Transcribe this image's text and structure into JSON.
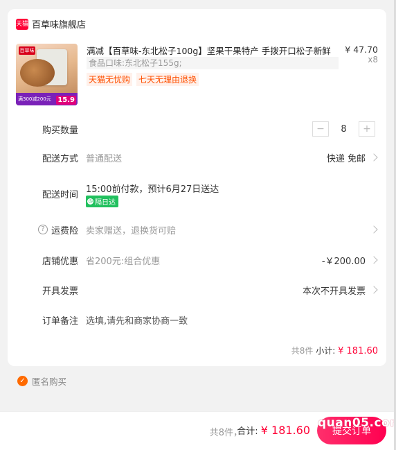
{
  "shop": {
    "logo_text": "天猫",
    "name": "百草味旗舰店"
  },
  "product": {
    "title": "满减【百草味-东北松子100g】坚果干果特产 手拨开口松子新鲜",
    "sku": "食品口味:东北松子155g;",
    "price": "¥ 47.70",
    "qty": "x8",
    "tags": [
      "天猫无忧购",
      "七天无理由退换"
    ],
    "image": {
      "brand": "百草味",
      "banner": "满300减200元",
      "price": "15.9"
    }
  },
  "rows": {
    "quantity": {
      "label": "购买数量",
      "minus": "−",
      "value": "8",
      "plus": "+"
    },
    "shipping": {
      "label": "配送方式",
      "value": "普通配送",
      "right": "快递 免邮"
    },
    "delivery_time": {
      "label": "配送时间",
      "value": "15:00前付款，预计6月27日送达",
      "badge": "隔日达"
    },
    "insurance": {
      "label": "运费险",
      "value": "卖家赠送，退换货可赔"
    },
    "discount": {
      "label": "店铺优惠",
      "value": "省200元:组合优惠",
      "right": "-￥200.00"
    },
    "invoice": {
      "label": "开具发票",
      "right": "本次不开具发票"
    },
    "note": {
      "label": "订单备注",
      "placeholder": "选填,请先和商家协商一致"
    }
  },
  "subtotal": {
    "count": "共8件",
    "label": "小计:",
    "amount": "¥ 181.60"
  },
  "anonymous": {
    "label": "匿名购买"
  },
  "bottom": {
    "count": "共8件，",
    "total_label": "合计:",
    "total_amount": "¥ 181.60",
    "submit": "提交订单",
    "watermark": "quan05.com"
  },
  "colors": {
    "accent": "#ff0036",
    "tag": "#ff5000",
    "badge_green": "#21c05e",
    "anon_orange": "#ff6a00"
  }
}
